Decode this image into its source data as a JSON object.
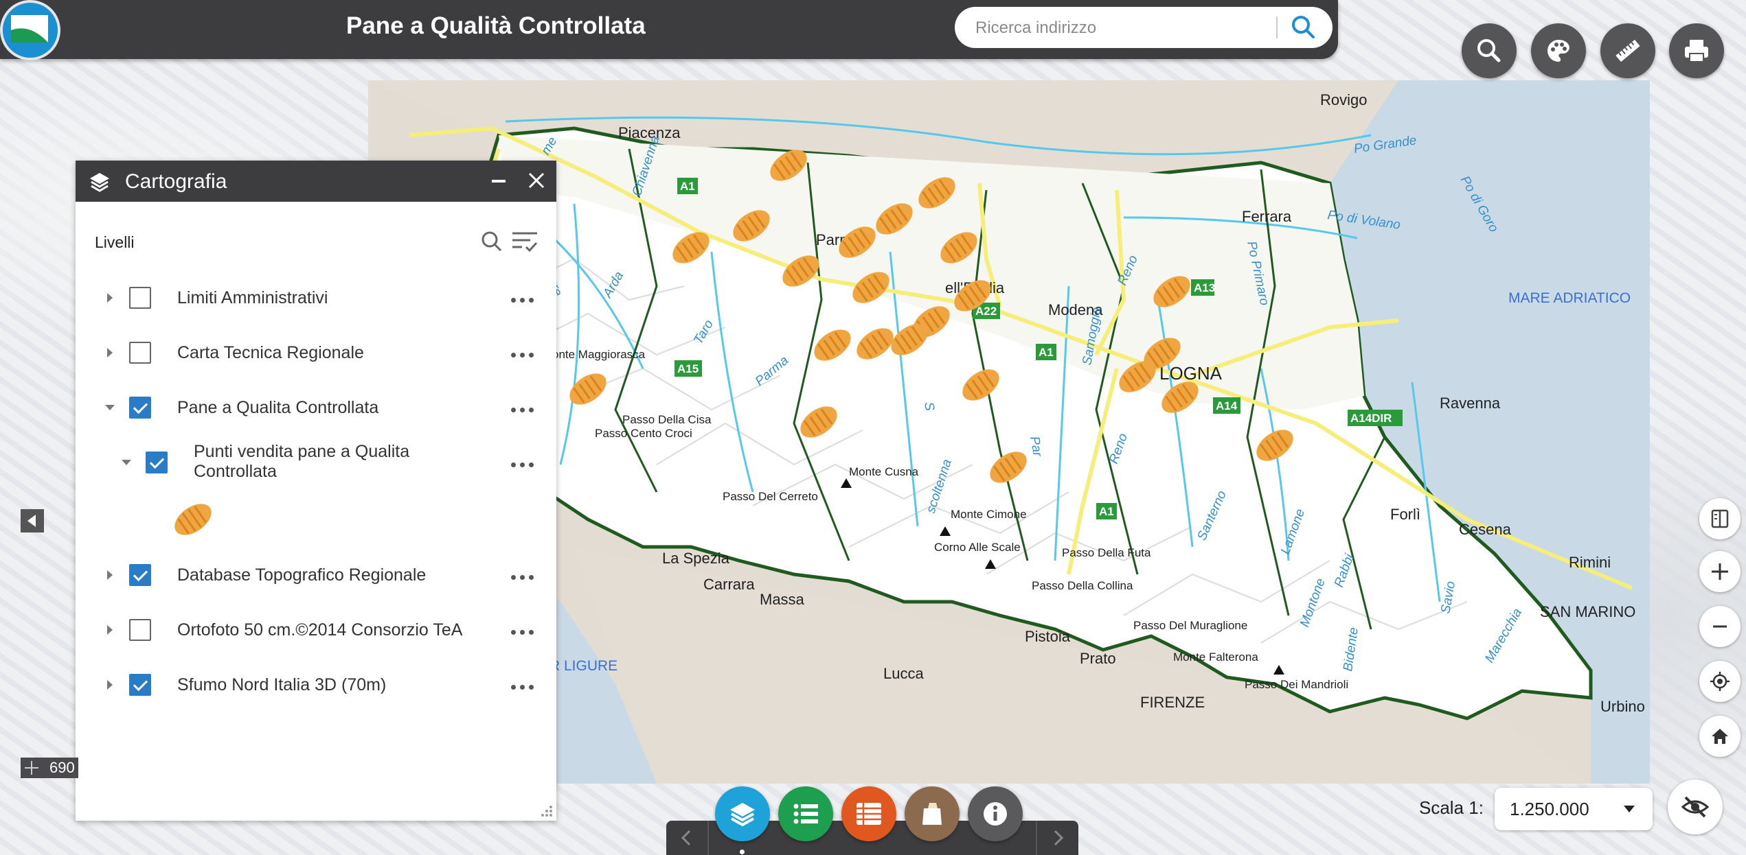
{
  "header": {
    "title": "Pane a Qualità Controllata",
    "search_placeholder": "Ricerca indirizzo"
  },
  "toolbar": {
    "buttons": [
      "search-icon",
      "palette-icon",
      "ruler-icon",
      "printer-icon"
    ],
    "color": "#555558"
  },
  "panel": {
    "title": "Cartografia",
    "levels_label": "Livelli",
    "layers": [
      {
        "label": "Limiti Amministrativi",
        "checked": false,
        "expanded": false
      },
      {
        "label": "Carta Tecnica Regionale",
        "checked": false,
        "expanded": false
      },
      {
        "label": "Pane a Qualita Controllata",
        "checked": true,
        "expanded": true
      },
      {
        "label": "Punti vendita pane a Qualita",
        "label2": "Controllata",
        "checked": true,
        "expanded": true,
        "sublayer": true
      },
      {
        "label": "Database Topografico Regionale",
        "checked": true,
        "expanded": false
      },
      {
        "label": "Ortofoto 50 cm.©2014 Consorzio TeA",
        "checked": false,
        "expanded": false
      },
      {
        "label": "Sfumo Nord Italia 3D (70m)",
        "checked": true,
        "expanded": false
      }
    ]
  },
  "map": {
    "places": {
      "rovigo": "Rovigo",
      "piacenza": "Piacenza",
      "parma": "Parm",
      "reggio": "ell'Emilia",
      "modena": "Modena",
      "ferrara": "Ferrara",
      "bologna": "LOGNA",
      "ravenna": "Ravenna",
      "forli": "Forlì",
      "cesena": "Cesena",
      "rimini": "Rimini",
      "san_marino": "SAN MARINO",
      "la_spezia": "La Spezia",
      "carrara": "Carrara",
      "massa": "Massa",
      "lucca": "Lucca",
      "pistoia": "Pistoia",
      "prato": "Prato",
      "firenze": "FIRENZE",
      "urbino": "Urbino",
      "mare_adriatico": "MARE ADRIATICO",
      "mar_ligure": "R LIGURE",
      "po_grande": "Po Grande",
      "po_volano": "Po di Volano",
      "po_goro": "Po di Goro",
      "po_primaro": "Po Primaro",
      "monte_maggiorasca": "onte Maggiorasca",
      "passo_cisa": "Passo Della Cisa",
      "passo_cento_croci": "Passo Cento Croci",
      "monte_cusna": "Monte Cusna",
      "passo_cerreto": "Passo Del Cerreto",
      "monte_cimone": "Monte Cimone",
      "corno_scale": "Corno Alle Scale",
      "passo_futa": "Passo Della Futa",
      "passo_collina": "Passo Della Collina",
      "passo_muraglione": "Passo Del Muraglione",
      "monte_falterona": "Monte Falterona",
      "passo_mandrioli": "Passo Dei Mandrioli"
    },
    "rivers": {
      "chiavenna": "Chiavenna",
      "arda": "Arda",
      "taro": "Taro",
      "parma": "Parma",
      "secchia": "S",
      "scoltenna": "scoltenna",
      "samoggia": "Samoggia",
      "reno": "Reno",
      "reno2": "Reno",
      "santerno": "Santerno",
      "lamone": "Lamone",
      "montone": "Montone",
      "rabbi": "Rabbi",
      "bidente": "Bidente",
      "savio": "Savio",
      "marecchia": "Marecchia",
      "pa": "Par",
      "trebbia": "ure",
      "ume": "me"
    },
    "roads": [
      "A1",
      "A15",
      "A22",
      "A1",
      "A13",
      "A14",
      "A14DIR",
      "A1"
    ],
    "marker_color": "#f0a640"
  },
  "coordinates": {
    "value": "690"
  },
  "scale": {
    "label": "Scala 1:",
    "value": "1.250.000"
  },
  "bottom_buttons": [
    {
      "icon": "layers-icon",
      "color": "#1ea2d8"
    },
    {
      "icon": "legend-list-icon",
      "color": "#1e9e4f"
    },
    {
      "icon": "table-icon",
      "color": "#e0571f"
    },
    {
      "icon": "bread-bag-icon",
      "color": "#8b6a4e"
    },
    {
      "icon": "info-icon",
      "color": "#5a5a5c"
    }
  ],
  "side_controls": [
    "layer-switcher-icon",
    "zoom-in-icon",
    "zoom-out-icon",
    "locate-icon",
    "home-icon",
    "hide-icon"
  ]
}
